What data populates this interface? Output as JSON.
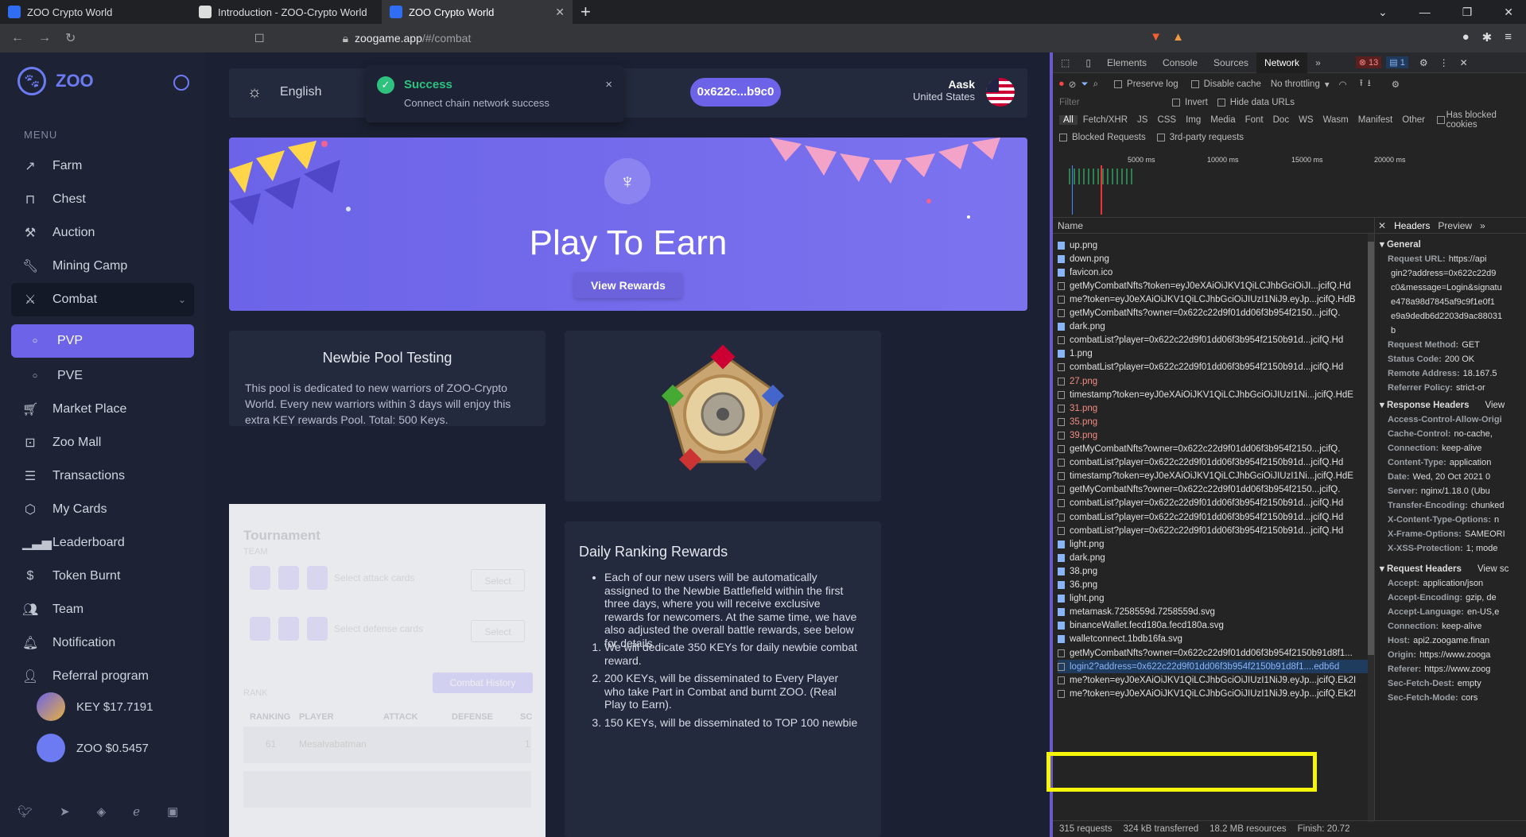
{
  "browser": {
    "tabs": [
      {
        "title": "ZOO Crypto World"
      },
      {
        "title": "Introduction - ZOO-Crypto World"
      },
      {
        "title": "ZOO Crypto World"
      }
    ],
    "new_tab": "+",
    "url_host": "zoogame.app",
    "url_path": "/#/combat"
  },
  "sidebar": {
    "brand": "ZOO",
    "menu_heading": "MENU",
    "items": [
      {
        "label": "Farm",
        "icon": "trend-icon"
      },
      {
        "label": "Chest",
        "icon": "lock-icon"
      },
      {
        "label": "Auction",
        "icon": "gavel-icon"
      },
      {
        "label": "Mining Camp",
        "icon": "wrench-icon"
      },
      {
        "label": "Combat",
        "icon": "swords-icon"
      },
      {
        "label": "PVP",
        "icon": "circle-icon"
      },
      {
        "label": "PVE",
        "icon": "circle-icon"
      },
      {
        "label": "Market Place",
        "icon": "cart-icon"
      },
      {
        "label": "Zoo Mall",
        "icon": "bag-icon"
      },
      {
        "label": "Transactions",
        "icon": "list-icon"
      },
      {
        "label": "My Cards",
        "icon": "cube-icon"
      },
      {
        "label": "Leaderboard",
        "icon": "bars-icon"
      },
      {
        "label": "Token Burnt",
        "icon": "dollar-icon"
      },
      {
        "label": "Team",
        "icon": "users-icon"
      },
      {
        "label": "Notification",
        "icon": "bell-icon"
      },
      {
        "label": "Referral program",
        "icon": "user-plus-icon"
      }
    ],
    "tokens": [
      {
        "label": "KEY $17.7191"
      },
      {
        "label": "ZOO $0.5457"
      }
    ]
  },
  "topbar": {
    "language": "English",
    "toast_title": "Success",
    "toast_message": "Connect chain network success",
    "toast_close": "×",
    "wallet": "0x622c...b9c0",
    "user_name": "Aask",
    "user_country": "United States"
  },
  "hero": {
    "title": "Play To Earn",
    "button": "View Rewards"
  },
  "pool": {
    "title": "Newbie Pool Testing",
    "text": "This pool is dedicated to new warriors of ZOO-Crypto World. Every new warriors within 3 days will enjoy this extra KEY rewards Pool. Total: 500 Keys."
  },
  "tournament": {
    "title": "Tournament",
    "team_label": "TEAM",
    "attack_label": "Select attack cards",
    "defense_label": "Select defense cards",
    "select": "Select",
    "history": "Combat History",
    "rank_label": "RANK",
    "columns": [
      "RANKING",
      "PLAYER",
      "ATTACK",
      "DEFENSE",
      "SC"
    ],
    "row_rank": "61",
    "row_player": "Mesalvabatman",
    "row_score": "1"
  },
  "daily": {
    "title": "Daily Ranking Rewards",
    "bullet": "Each of our new users will be automatically assigned to the Newbie Battlefield within the first three days, where you will receive exclusive rewards for newcomers. At the same time, we have also adjusted the overall battle rewards, see below for details",
    "items": [
      "We will dedicate 350 KEYs for daily newbie combat reward.",
      "200 KEYs, will be disseminated to Every Player who take Part in Combat and burnt ZOO. (Real Play to Earn).",
      "150 KEYs, will be disseminated to TOP 100 newbie"
    ]
  },
  "devtools": {
    "tabs": [
      "Elements",
      "Console",
      "Sources",
      "Network"
    ],
    "errors": "13",
    "warnings": "1",
    "preserve_log": "Preserve log",
    "disable_cache": "Disable cache",
    "throttling": "No throttling",
    "filter_placeholder": "Filter",
    "invert": "Invert",
    "hide_data": "Hide data URLs",
    "filters": [
      "All",
      "Fetch/XHR",
      "JS",
      "CSS",
      "Img",
      "Media",
      "Font",
      "Doc",
      "WS",
      "Wasm",
      "Manifest",
      "Other"
    ],
    "blocked_cookies": "Has blocked cookies",
    "blocked_requests": "Blocked Requests",
    "third_party": "3rd-party requests",
    "timeline_ticks": [
      "5000 ms",
      "10000 ms",
      "15000 ms",
      "20000 ms"
    ],
    "name_header": "Name",
    "requests": [
      {
        "name": "up.png",
        "kind": "img"
      },
      {
        "name": "down.png",
        "kind": "img"
      },
      {
        "name": "favicon.ico",
        "kind": "img"
      },
      {
        "name": "getMyCombatNfts?token=eyJ0eXAiOiJKV1QiLCJhbGciOiJI...jcifQ.Hd",
        "kind": "xhr"
      },
      {
        "name": "me?token=eyJ0eXAiOiJKV1QiLCJhbGciOiJIUzI1NiJ9.eyJp...jcifQ.HdB",
        "kind": "xhr"
      },
      {
        "name": "getMyCombatNfts?owner=0x622c22d9f01dd06f3b954f2150...jcifQ.",
        "kind": "xhr"
      },
      {
        "name": "dark.png",
        "kind": "img"
      },
      {
        "name": "combatList?player=0x622c22d9f01dd06f3b954f2150b91d...jcifQ.Hd",
        "kind": "xhr"
      },
      {
        "name": "1.png",
        "kind": "img"
      },
      {
        "name": "combatList?player=0x622c22d9f01dd06f3b954f2150b91d...jcifQ.Hd",
        "kind": "xhr"
      },
      {
        "name": "27.png",
        "kind": "red"
      },
      {
        "name": "timestamp?token=eyJ0eXAiOiJKV1QiLCJhbGciOiJIUzI1Ni...jcifQ.HdE",
        "kind": "xhr"
      },
      {
        "name": "31.png",
        "kind": "red"
      },
      {
        "name": "35.png",
        "kind": "red"
      },
      {
        "name": "39.png",
        "kind": "red"
      },
      {
        "name": "getMyCombatNfts?owner=0x622c22d9f01dd06f3b954f2150...jcifQ.",
        "kind": "xhr"
      },
      {
        "name": "combatList?player=0x622c22d9f01dd06f3b954f2150b91d...jcifQ.Hd",
        "kind": "xhr"
      },
      {
        "name": "timestamp?token=eyJ0eXAiOiJKV1QiLCJhbGciOiJIUzI1Ni...jcifQ.HdE",
        "kind": "xhr"
      },
      {
        "name": "getMyCombatNfts?owner=0x622c22d9f01dd06f3b954f2150...jcifQ.",
        "kind": "xhr"
      },
      {
        "name": "combatList?player=0x622c22d9f01dd06f3b954f2150b91d...jcifQ.Hd",
        "kind": "xhr"
      },
      {
        "name": "combatList?player=0x622c22d9f01dd06f3b954f2150b91d...jcifQ.Hd",
        "kind": "xhr"
      },
      {
        "name": "combatList?player=0x622c22d9f01dd06f3b954f2150b91d...jcifQ.Hd",
        "kind": "xhr"
      },
      {
        "name": "light.png",
        "kind": "img"
      },
      {
        "name": "dark.png",
        "kind": "img"
      },
      {
        "name": "38.png",
        "kind": "img"
      },
      {
        "name": "36.png",
        "kind": "img"
      },
      {
        "name": "light.png",
        "kind": "img"
      },
      {
        "name": "metamask.7258559d.7258559d.svg",
        "kind": "img"
      },
      {
        "name": "binanceWallet.fecd180a.fecd180a.svg",
        "kind": "img"
      },
      {
        "name": "walletconnect.1bdb16fa.svg",
        "kind": "img"
      },
      {
        "name": "getMyCombatNfts?owner=0x622c22d9f01dd06f3b954f2150b91d8f1...",
        "kind": "xhr"
      },
      {
        "name": "login2?address=0x622c22d9f01dd06f3b954f2150b91d8f1....edb6d",
        "kind": "sel"
      },
      {
        "name": "me?token=eyJ0eXAiOiJKV1QiLCJhbGciOiJIUzI1NiJ9.eyJp...jcifQ.Ek2I",
        "kind": "xhr"
      },
      {
        "name": "me?token=eyJ0eXAiOiJKV1QiLCJhbGciOiJIUzI1NiJ9.eyJp...jcifQ.Ek2I",
        "kind": "xhr"
      }
    ],
    "detail_tabs": [
      "Headers",
      "Preview"
    ],
    "general": "General",
    "general_rows": [
      {
        "k": "Request URL:",
        "v": "https://api"
      },
      {
        "k": "",
        "v": "gin2?address=0x622c22d9"
      },
      {
        "k": "",
        "v": "c0&message=Login&signatu"
      },
      {
        "k": "",
        "v": "e478a98d7845af9c9f1e0f1"
      },
      {
        "k": "",
        "v": "e9a9dedb6d2203d9ac88031"
      },
      {
        "k": "",
        "v": "b"
      },
      {
        "k": "Request Method:",
        "v": "GET"
      },
      {
        "k": "Status Code:",
        "v": "200 OK"
      },
      {
        "k": "Remote Address:",
        "v": "18.167.5"
      },
      {
        "k": "Referrer Policy:",
        "v": "strict-or"
      }
    ],
    "response_headers": "Response Headers",
    "view_source": "View",
    "response_rows": [
      {
        "k": "Access-Control-Allow-Origi",
        "v": ""
      },
      {
        "k": "Cache-Control:",
        "v": "no-cache,"
      },
      {
        "k": "Connection:",
        "v": "keep-alive"
      },
      {
        "k": "Content-Type:",
        "v": "application"
      },
      {
        "k": "Date:",
        "v": "Wed, 20 Oct 2021 0"
      },
      {
        "k": "Server:",
        "v": "nginx/1.18.0 (Ubu"
      },
      {
        "k": "Transfer-Encoding:",
        "v": "chunked"
      },
      {
        "k": "X-Content-Type-Options:",
        "v": "n"
      },
      {
        "k": "X-Frame-Options:",
        "v": "SAMEORI"
      },
      {
        "k": "X-XSS-Protection:",
        "v": "1; mode"
      }
    ],
    "request_headers": "Request Headers",
    "view_source2": "View sc",
    "request_rows": [
      {
        "k": "Accept:",
        "v": "application/json"
      },
      {
        "k": "Accept-Encoding:",
        "v": "gzip, de"
      },
      {
        "k": "Accept-Language:",
        "v": "en-US,e"
      },
      {
        "k": "Connection:",
        "v": "keep-alive"
      },
      {
        "k": "Host:",
        "v": "api2.zoogame.finan"
      },
      {
        "k": "Origin:",
        "v": "https://www.zooga"
      },
      {
        "k": "Referer:",
        "v": "https://www.zoog"
      },
      {
        "k": "Sec-Fetch-Dest:",
        "v": "empty"
      },
      {
        "k": "Sec-Fetch-Mode:",
        "v": "cors"
      }
    ],
    "status_bar": [
      "315 requests",
      "324 kB transferred",
      "18.2 MB resources",
      "Finish: 20.72"
    ]
  }
}
